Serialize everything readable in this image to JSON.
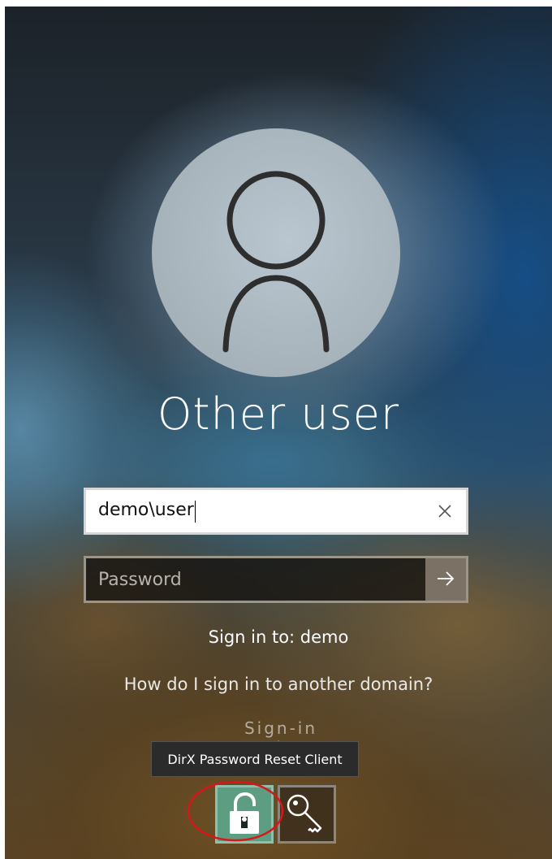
{
  "login": {
    "user_name": "Other user",
    "username_value": "demo\\user",
    "password_placeholder": "Password",
    "sign_in_to": "Sign in to: demo",
    "domain_help_link": "How do I sign in to another domain?",
    "partially_hidden_link": "Sign-in options"
  },
  "icons": {
    "avatar": "user-silhouette-icon",
    "clear": "close-x-icon",
    "submit": "arrow-right-icon",
    "provider_lock": "padlock-icon",
    "provider_key": "key-icon"
  },
  "tooltip": {
    "text": "DirX Password Reset Client"
  },
  "colors": {
    "lock_tile": "#5d9e83",
    "highlight_circle": "#d8161b",
    "submit_button": "#7b7165"
  }
}
